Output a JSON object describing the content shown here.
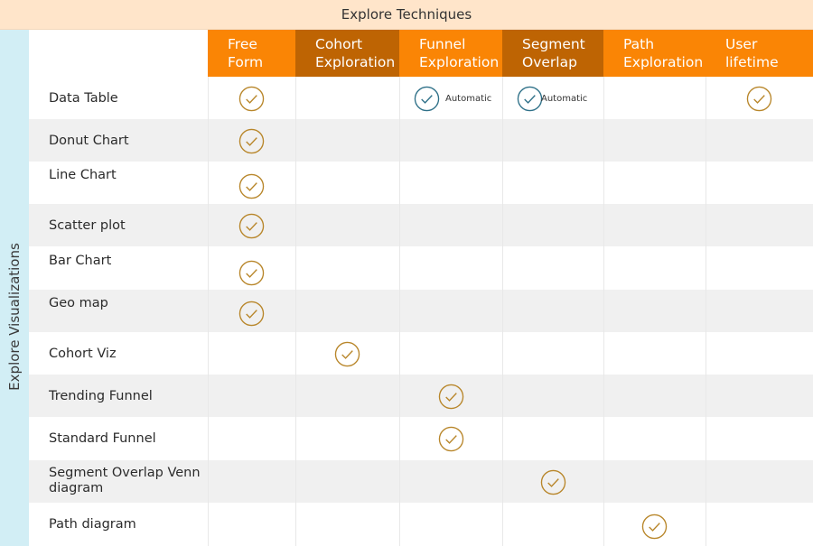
{
  "top_title": "Explore Techniques",
  "side_title": "Explore Visualizations",
  "colors": {
    "header_orange": "#FA8505",
    "header_brown": "#BE6403",
    "top_band": "#FFE5CA",
    "side_band": "#D2EEF5",
    "check_gold": "#B8862A",
    "check_teal": "#2E7088",
    "row_alt": "#F0F0F0"
  },
  "columns": [
    {
      "label_line1": "Free",
      "label_line2": "Form",
      "style": "orange"
    },
    {
      "label_line1": "Cohort",
      "label_line2": "Exploration",
      "style": "brown"
    },
    {
      "label_line1": "Funnel",
      "label_line2": "Exploration",
      "style": "orange"
    },
    {
      "label_line1": "Segment",
      "label_line2": "Overlap",
      "style": "brown"
    },
    {
      "label_line1": "Path",
      "label_line2": "Exploration",
      "style": "orange"
    },
    {
      "label_line1": "User",
      "label_line2": "lifetime",
      "style": "orange"
    }
  ],
  "rows": [
    {
      "label": "Data Table",
      "checks": [
        {
          "col": 0,
          "type": "supported"
        },
        {
          "col": 2,
          "type": "automatic",
          "note": "Automatic"
        },
        {
          "col": 3,
          "type": "automatic",
          "note": "Automatic"
        },
        {
          "col": 5,
          "type": "supported"
        }
      ]
    },
    {
      "label": "Donut Chart",
      "checks": [
        {
          "col": 0,
          "type": "supported"
        }
      ]
    },
    {
      "label": "Line Chart",
      "checks": [
        {
          "col": 0,
          "type": "supported"
        }
      ]
    },
    {
      "label": "Scatter plot",
      "checks": [
        {
          "col": 0,
          "type": "supported"
        }
      ]
    },
    {
      "label": "Bar Chart",
      "checks": [
        {
          "col": 0,
          "type": "supported"
        }
      ]
    },
    {
      "label": "Geo map",
      "checks": [
        {
          "col": 0,
          "type": "supported"
        }
      ]
    },
    {
      "label": "Cohort Viz",
      "checks": [
        {
          "col": 1,
          "type": "supported"
        }
      ]
    },
    {
      "label": "Trending Funnel",
      "checks": [
        {
          "col": 2,
          "type": "supported"
        }
      ]
    },
    {
      "label": "Standard Funnel",
      "checks": [
        {
          "col": 2,
          "type": "supported"
        }
      ]
    },
    {
      "label": "Segment Overlap Venn diagram",
      "checks": [
        {
          "col": 3,
          "type": "supported"
        }
      ]
    },
    {
      "label": "Path diagram",
      "checks": [
        {
          "col": 4,
          "type": "supported"
        }
      ]
    }
  ]
}
